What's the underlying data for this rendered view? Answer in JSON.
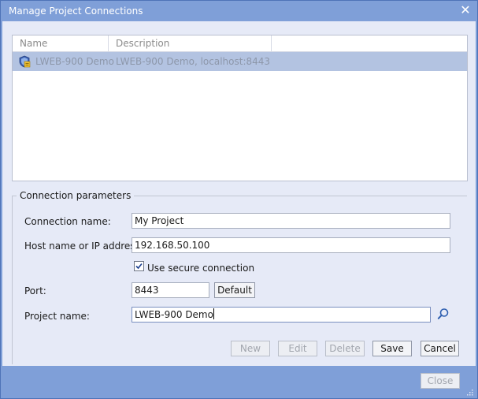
{
  "window": {
    "title": "Manage Project Connections"
  },
  "list": {
    "columns": [
      "Name",
      "Description"
    ],
    "rows": [
      {
        "name": "LWEB-900 Demo",
        "description": "LWEB-900 Demo, localhost:8443"
      }
    ]
  },
  "connection": {
    "group_label": "Connection parameters",
    "connection_name_label": "Connection name:",
    "connection_name_value": "My Project",
    "host_label": "Host name or IP address:",
    "host_value": "192.168.50.100",
    "secure_label": "Use secure connection",
    "secure_checked": true,
    "port_label": "Port:",
    "port_value": "8443",
    "default_button": "Default",
    "project_label": "Project name:",
    "project_value": "LWEB-900 Demo"
  },
  "actions": {
    "new": "New",
    "edit": "Edit",
    "delete": "Delete",
    "save": "Save",
    "cancel": "Cancel"
  },
  "footer": {
    "close": "Close"
  },
  "icons": {
    "window_close": "close-icon",
    "row": "project-server-icon",
    "search": "search-icon",
    "grip": "resize-grip-icon"
  },
  "colors": {
    "titlebar": "#7f9fd8",
    "client": "#e6eaf7",
    "selected_row": "#b3c3e1"
  }
}
